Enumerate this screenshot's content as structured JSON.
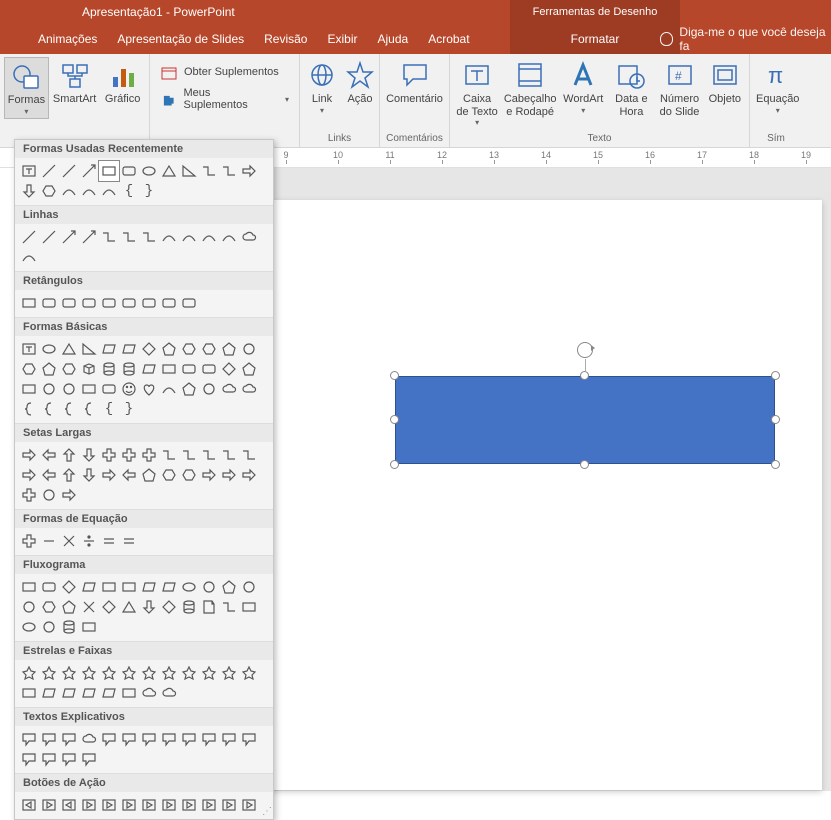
{
  "app": {
    "title": "Apresentação1 - PowerPoint",
    "tools_tab": "Ferramentas de Desenho"
  },
  "tabs": {
    "animacoes": "Animações",
    "apresentacao": "Apresentação de Slides",
    "revisao": "Revisão",
    "exibir": "Exibir",
    "ajuda": "Ajuda",
    "acrobat": "Acrobat",
    "formatar": "Formatar",
    "tellme": "Diga-me o que você deseja fa"
  },
  "ribbon": {
    "formas": "Formas",
    "smartart": "SmartArt",
    "grafico": "Gráfico",
    "obter_supl": "Obter Suplementos",
    "meus_supl": "Meus Suplementos",
    "link": "Link",
    "acao": "Ação",
    "comentario": "Comentário",
    "caixa_texto": "Caixa de Texto",
    "cabecalho": "Cabeçalho e Rodapé",
    "wordart": "WordArt",
    "data_hora": "Data e Hora",
    "num_slide": "Número do Slide",
    "objeto": "Objeto",
    "equacao": "Equação",
    "grp_links": "Links",
    "grp_coment": "Comentários",
    "grp_texto": "Texto",
    "grp_simb": "Sím"
  },
  "ruler": {
    "marks": [
      "9",
      "10",
      "11",
      "12",
      "13",
      "14",
      "15",
      "16",
      "17",
      "18",
      "19"
    ]
  },
  "panel": {
    "recent": "Formas Usadas Recentemente",
    "linhas": "Linhas",
    "retangulos": "Retângulos",
    "basicas": "Formas Básicas",
    "setas": "Setas Largas",
    "equacao": "Formas de Equação",
    "fluxo": "Fluxograma",
    "estrelas": "Estrelas e Faixas",
    "textos": "Textos Explicativos",
    "botoes": "Botões de Ação",
    "brace_l": "{",
    "brace_r": "}"
  },
  "shape": {
    "fill": "#4472c4"
  }
}
